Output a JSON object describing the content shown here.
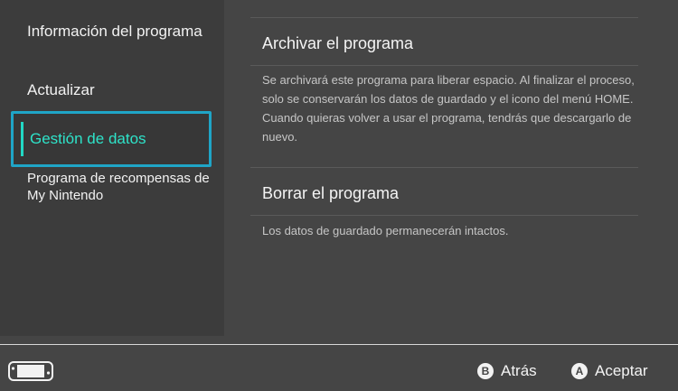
{
  "sidebar": {
    "items": [
      {
        "label": "Información del programa"
      },
      {
        "label": "Actualizar"
      },
      {
        "label": "Gestión de datos"
      },
      {
        "label": "Programa de recompensas de My Nintendo"
      }
    ]
  },
  "main": {
    "sections": [
      {
        "title": "Archivar el programa",
        "description": "Se archivará este programa para liberar espacio. Al finalizar el proceso, solo se conservarán los datos de guardado y el icono del menú HOME. Cuando quieras volver a usar el programa, tendrás que descargarlo de nuevo."
      },
      {
        "title": "Borrar el programa",
        "description": "Los datos de guardado permanecerán intactos."
      }
    ]
  },
  "footer": {
    "console_icon": "handheld-console-icon",
    "back": {
      "key": "B",
      "label": "Atrás"
    },
    "accept": {
      "key": "A",
      "label": "Aceptar"
    }
  },
  "colors": {
    "background": "#454545",
    "sidebar": "#3c3c3c",
    "selection_border": "#1fa5c7",
    "selection_text": "#2ee3c9"
  }
}
